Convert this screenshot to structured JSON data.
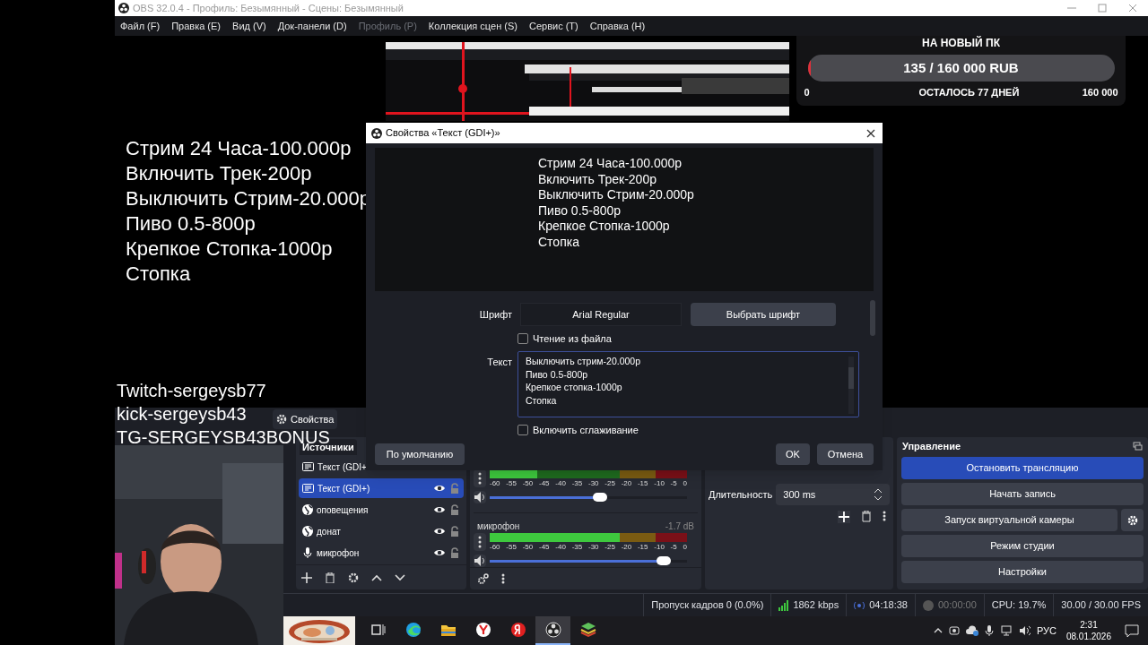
{
  "window": {
    "title": "OBS 32.0.4 - Профиль: Безымянный - Сцены: Безымянный"
  },
  "menu": [
    {
      "label": "Файл (F)",
      "disabled": false
    },
    {
      "label": "Правка (E)",
      "disabled": false
    },
    {
      "label": "Вид (V)",
      "disabled": false
    },
    {
      "label": "Док-панели (D)",
      "disabled": false
    },
    {
      "label": "Профиль (P)",
      "disabled": true
    },
    {
      "label": "Коллекция сцен (S)",
      "disabled": false
    },
    {
      "label": "Сервис (T)",
      "disabled": false
    },
    {
      "label": "Справка (H)",
      "disabled": false
    }
  ],
  "preview": {
    "text_lines": [
      "Стрим 24 Часа-100.000р",
      "Включить Трек-200р",
      "Выключить Стрим-20.000р",
      "Пиво 0.5-800р",
      "Крепкое Стопка-1000р",
      "Стопка"
    ],
    "donation_goal": {
      "title": "НА НОВЫЙ ПК",
      "progress": "135 / 160 000 RUB",
      "level": 0.01,
      "start": "0",
      "remaining": "ОСТАЛОСЬ 77 ДНЕЙ",
      "target": "160 000"
    },
    "overlay_lines": [
      "Twitch-sergeysb77",
      "kick-sergeysb43",
      "TG-SERGEYSB43BONUS"
    ]
  },
  "toolbar": {
    "properties_button": "Свойства"
  },
  "dialog": {
    "title": "Свойства «Текст (GDI+)»",
    "preview_lines": [
      "Стрим 24 Часа-100.000р",
      "Включить Трек-200р",
      "Выключить Стрим-20.000р",
      "Пиво 0.5-800р",
      "Крепкое Стопка-1000р",
      "Стопка"
    ],
    "font_label": "Шрифт",
    "font": "Arial Regular",
    "choose_font": "Выбрать шрифт",
    "read_from_file": {
      "label": "Чтение из файла",
      "checked": false
    },
    "text_label": "Текст",
    "text_lines": [
      "Выключить стрим-20.000р",
      "Пиво 0.5-800р",
      "Крепкое стопка-1000р",
      "Стопка"
    ],
    "antialias": {
      "label": "Включить сглаживание",
      "checked": false
    },
    "defaults_button": "По умолчанию",
    "ok_button": "OK",
    "cancel_button": "Отмена"
  },
  "sources": {
    "title": "Источники",
    "items": [
      {
        "name": "Текст (GDI+",
        "kind": "text",
        "selected": false
      },
      {
        "name": "Текст (GDI+)",
        "kind": "text",
        "selected": true
      },
      {
        "name": "оповещения",
        "kind": "browser",
        "selected": false
      },
      {
        "name": "донат",
        "kind": "browser",
        "selected": false
      },
      {
        "name": "микрофон",
        "kind": "audio",
        "selected": false
      }
    ]
  },
  "mixer": {
    "channels": [
      {
        "meter": {
          "level": 0.24
        },
        "scale": [
          "-60",
          "-55",
          "-50",
          "-45",
          "-40",
          "-35",
          "-30",
          "-25",
          "-20",
          "-15",
          "-10",
          "-5",
          "0"
        ],
        "volume": {
          "level": 0.56
        }
      },
      {
        "name": "микрофон",
        "reading": "-1.7 dB",
        "meter": {
          "level": 0.7
        },
        "scale": [
          "-60",
          "-55",
          "-50",
          "-45",
          "-40",
          "-35",
          "-30",
          "-25",
          "-20",
          "-15",
          "-10",
          "-5",
          "0"
        ],
        "volume": {
          "level": 0.88
        }
      }
    ]
  },
  "transitions": {
    "duration_label": "Длительность",
    "duration": "300 ms"
  },
  "controls": {
    "title": "Управление",
    "buttons": [
      {
        "label": "Остановить трансляцию",
        "active": true
      },
      {
        "label": "Начать запись",
        "active": false
      },
      {
        "label": "Запуск виртуальной камеры",
        "active": false
      },
      {
        "label": "Режим студии",
        "active": false
      },
      {
        "label": "Настройки",
        "active": false
      }
    ]
  },
  "status_bar": {
    "dropped": "Пропуск кадров 0 (0.0%)",
    "bitrate": "1862 kbps",
    "stream_time": "04:18:38",
    "record_time": "00:00:00",
    "cpu": "CPU: 19.7%",
    "fps": "30.00 / 30.00 FPS"
  },
  "taskbar": {
    "apps": [
      {
        "kind": "taskview",
        "selected": false
      },
      {
        "kind": "edge",
        "selected": false
      },
      {
        "kind": "folder",
        "selected": false
      },
      {
        "kind": "ybrowser",
        "selected": false
      },
      {
        "kind": "yandex",
        "selected": false
      },
      {
        "kind": "obs",
        "selected": true
      },
      {
        "kind": "stack",
        "selected": false
      }
    ],
    "language": "РУС",
    "time": "2:31",
    "date": "08.01.2026"
  }
}
